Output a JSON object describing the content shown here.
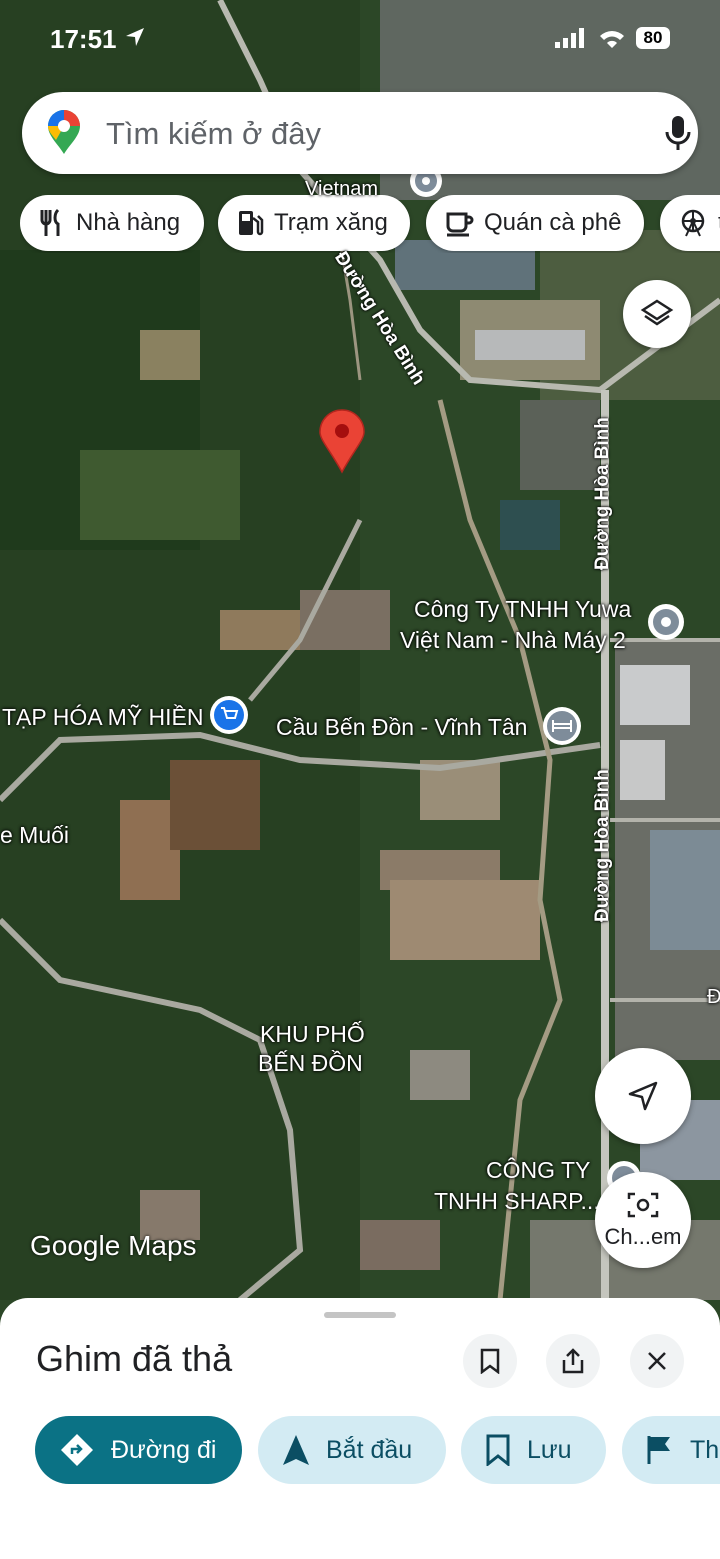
{
  "status_bar": {
    "time": "17:51",
    "battery": "80"
  },
  "search": {
    "placeholder": "Tìm kiếm ở đây"
  },
  "chips": [
    {
      "label": "Nhà hàng",
      "icon": "fork-knife-icon"
    },
    {
      "label": "Trạm xăng",
      "icon": "gas-station-icon"
    },
    {
      "label": "Quán cà phê",
      "icon": "coffee-cup-icon"
    },
    {
      "label": "t",
      "icon": "ferris-wheel-icon"
    }
  ],
  "map_labels": {
    "vietnam_partial": "Vietnam",
    "road1": "Đường Hòa Bình",
    "road2": "Đường Hòa Bình",
    "road3": "Đường Hòa Bình",
    "yuwa_line1": "Công Ty TNHH Yuwa",
    "yuwa_line2": "Việt Nam - Nhà Máy 2",
    "taphoa": "TẠP HÓA MỸ HIỀN",
    "caubenden": "Cầu Bến Đồn - Vĩnh Tân",
    "emuoi": "e Muối",
    "khupho_line1": "KHU PHỐ",
    "khupho_line2": "BẾN ĐỒN",
    "sharp_line1": "CÔNG TY",
    "sharp_line2": "TNHH SHARP...",
    "edge_d": "Đ",
    "google_maps": "Google Maps"
  },
  "buttons": {
    "camera_label": "Ch...em"
  },
  "sheet": {
    "title": "Ghim đã thả",
    "actions": [
      {
        "label": "Đường đi",
        "icon": "directions-icon"
      },
      {
        "label": "Bắt đầu",
        "icon": "navigation-arrow-icon"
      },
      {
        "label": "Lưu",
        "icon": "bookmark-icon"
      },
      {
        "label": "Th",
        "icon": "flag-icon"
      }
    ]
  },
  "colors": {
    "primary_action": "#0b7285",
    "secondary_action": "#d3ebf3",
    "pin": "#ea4335"
  }
}
